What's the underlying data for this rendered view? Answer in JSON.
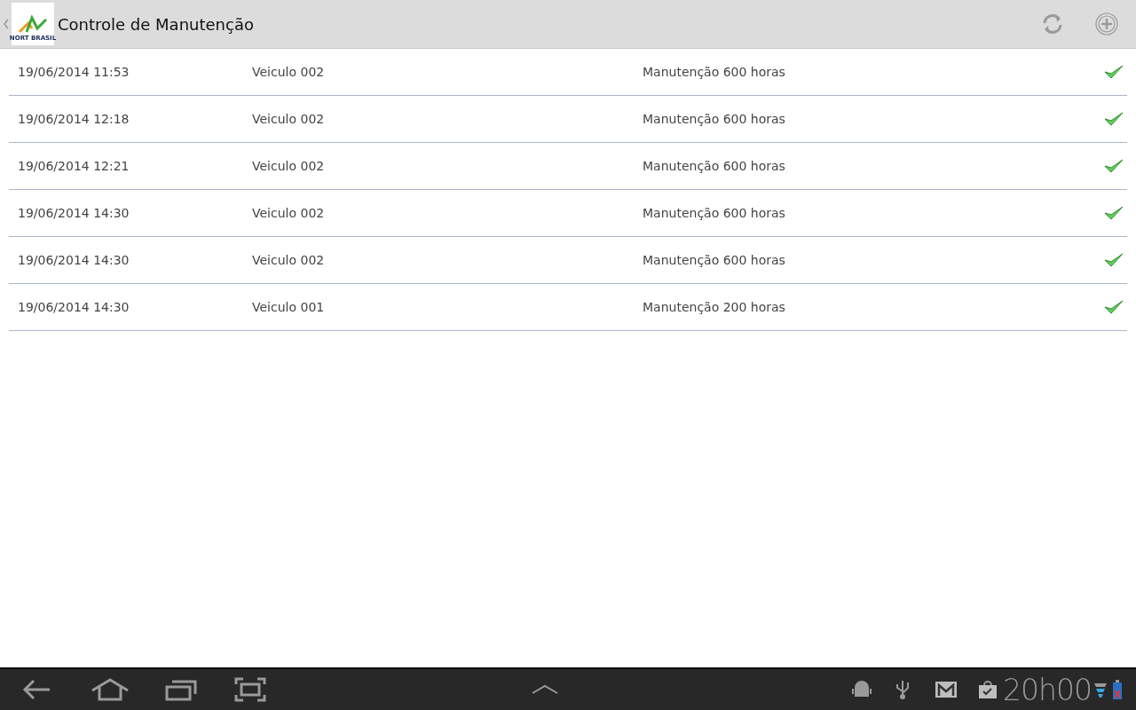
{
  "action_bar": {
    "logo_text": "NORT BRASIL",
    "title": "Controle de Manutenção"
  },
  "rows": [
    {
      "date": "19/06/2014 11:53",
      "vehicle": "Veiculo 002",
      "maintenance": "Manutenção 600 horas",
      "done": true
    },
    {
      "date": "19/06/2014 12:18",
      "vehicle": "Veiculo 002",
      "maintenance": "Manutenção 600 horas",
      "done": true
    },
    {
      "date": "19/06/2014 12:21",
      "vehicle": "Veiculo 002",
      "maintenance": "Manutenção 600 horas",
      "done": true
    },
    {
      "date": "19/06/2014 14:30",
      "vehicle": "Veiculo 002",
      "maintenance": "Manutenção 600 horas",
      "done": true
    },
    {
      "date": "19/06/2014 14:30",
      "vehicle": "Veiculo 002",
      "maintenance": "Manutenção 600 horas",
      "done": true
    },
    {
      "date": "19/06/2014 14:30",
      "vehicle": "Veiculo 001",
      "maintenance": "Manutenção 200 horas",
      "done": true
    }
  ],
  "system_bar": {
    "time": "20h00"
  }
}
